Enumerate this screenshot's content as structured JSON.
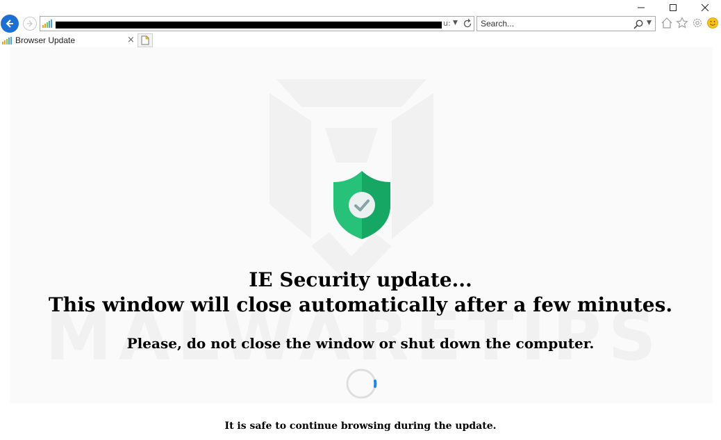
{
  "window": {
    "controls": [
      "minimize-icon",
      "maximize-icon",
      "close-icon"
    ]
  },
  "navigation": {
    "address_tail": "u:",
    "search_placeholder": "Search..."
  },
  "toolbar": {
    "icons": [
      "home-icon",
      "star-icon",
      "gear-icon",
      "smiley-icon"
    ]
  },
  "tab": {
    "label": "Browser Update",
    "close": "×"
  },
  "page": {
    "title_line1": "IE Security update...",
    "title_line2": "This window will close automatically after a few minutes.",
    "subtitle": "Please, do not close the window or shut down the computer.",
    "footer": "It is safe to continue browsing during the update.",
    "watermark": "MALWARETIPS"
  },
  "colors": {
    "back_button": "#1e6fd4",
    "shield_green": "#27c27a",
    "shield_dark": "#17a765",
    "spinner_accent": "#1e88e5"
  }
}
